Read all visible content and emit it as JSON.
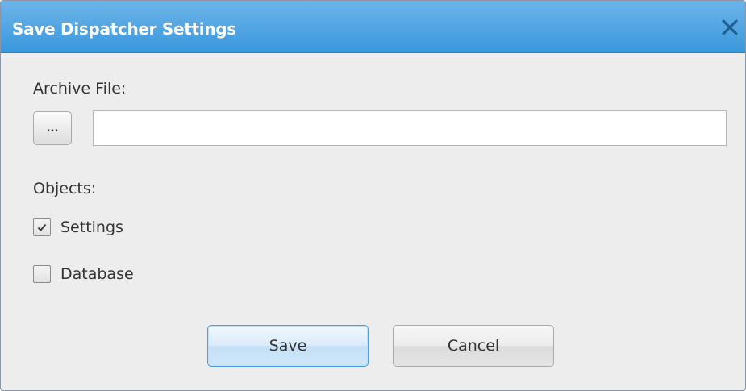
{
  "window": {
    "title": "Save Dispatcher Settings",
    "close_icon": "close-icon"
  },
  "archive": {
    "label": "Archive File:",
    "browse_label": "...",
    "file_value": "",
    "file_placeholder": ""
  },
  "objects": {
    "label": "Objects:",
    "items": [
      {
        "label": "Settings",
        "checked": true
      },
      {
        "label": "Database",
        "checked": false
      }
    ]
  },
  "buttons": {
    "save_label": "Save",
    "cancel_label": "Cancel"
  },
  "colors": {
    "titlebar": "#3a97dc",
    "accent_border": "#4c9ee0",
    "close_icon": "#1f5f94"
  }
}
